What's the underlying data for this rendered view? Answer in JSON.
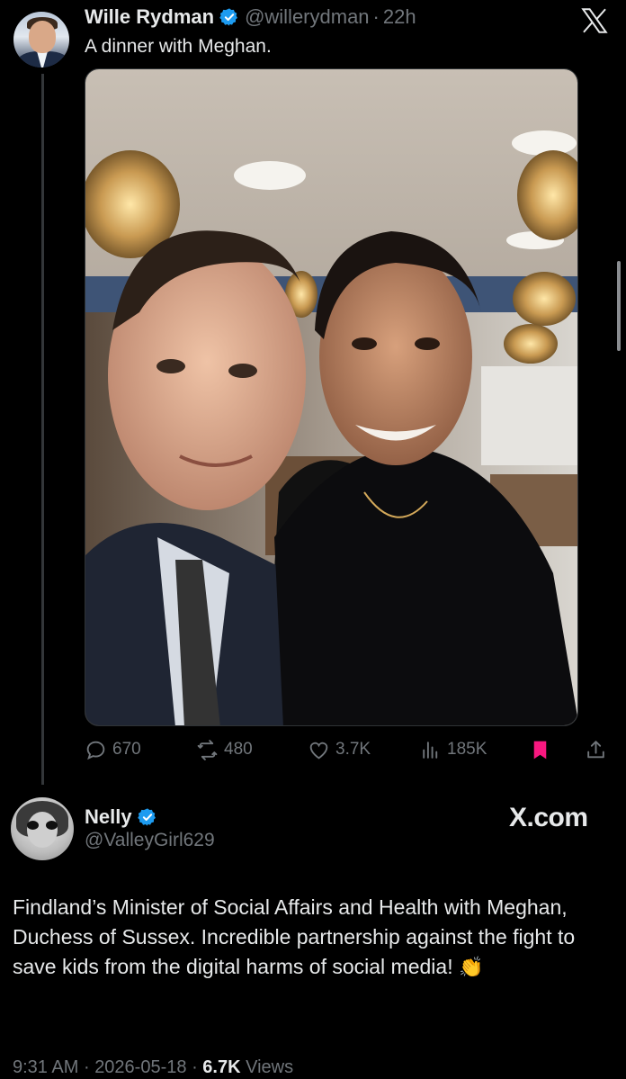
{
  "tweet": {
    "author_name": "Wille Rydman",
    "handle": "@willerydman",
    "separator": "·",
    "time": "22h",
    "text": "A dinner with Meghan.",
    "stats": {
      "replies": "670",
      "reposts": "480",
      "likes": "3.7K",
      "views": "185K"
    },
    "bookmark_color": "#f91880",
    "avatar_icon": "profile-photo-man-suit"
  },
  "embed": {
    "author_name": "Nelly",
    "handle": "@ValleyGirl629",
    "brand": "X.com",
    "text": "Findland’s Minister of Social Affairs and Health with Meghan, Duchess of Sussex. Incredible partnership against the fight to save kids from the digital harms of social media!",
    "emoji": "👏",
    "timestamp": "9:31 AM",
    "date": "2026-05-18",
    "sep1": "·",
    "sep2": "·",
    "views_count": "6.7K",
    "views_label": "Views"
  },
  "colors": {
    "background": "#000000",
    "text_primary": "#e7e9ea",
    "text_secondary": "#71767b",
    "verified": "#1d9bf0",
    "thread_line": "#333639"
  }
}
